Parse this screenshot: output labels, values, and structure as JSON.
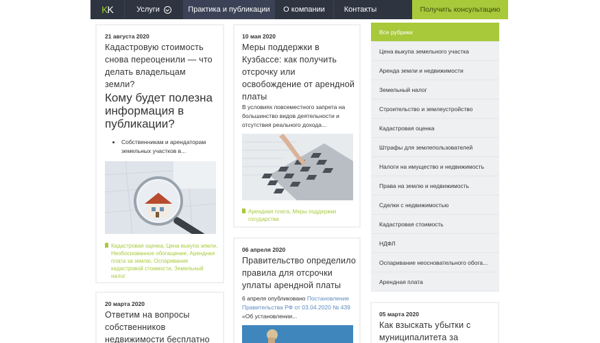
{
  "nav": {
    "logo_k1": "K",
    "logo_k2": "K",
    "services": "Услуги",
    "practice": "Практика и публикации",
    "company": "О компании",
    "contacts": "Контакты",
    "cta": "Получить консультацию"
  },
  "card1": {
    "date": "21 августа 2020",
    "title": "Кадастровую стоимость снова переоценили — что делать владельцам земли?",
    "subtitle": "Кому будет полезна информация в публикации?",
    "bullet": "Собственникам и арендаторам земельных участков в...",
    "tags": "Кадастровая оценка, Цена выкупа земли, Необоснованное обогащение, Арендная плата за землю, Оспаривание кадастровой стоимости, Земельный налог"
  },
  "card2": {
    "date": "10 мая 2020",
    "title": "Меры поддержки в Кузбассе: как получить отсрочку или освобождение от арендной платы",
    "text": "В условиях повсеместного запрета на большинство видов деятельности и отсутствия реального дохода...",
    "tags": "Арендная плата, Меры поддержки государства"
  },
  "card3": {
    "date": "06 апреля 2020",
    "title": "Правительство определило правила для отсрочки уплаты арендной платы",
    "text_prefix": "6 апреля опубликовано ",
    "text_link": "Постановление Правительства РФ от 03.04.2020 № 439",
    "text_suffix": " «Об установлении..."
  },
  "card4": {
    "date": "20 марта 2020",
    "title": "Ответим на вопросы собственников недвижимости бесплатно"
  },
  "card5": {
    "date": "05 марта 2020",
    "title": "Как взыскать убытки с муниципалитета за"
  },
  "sidebar": {
    "items": [
      "Все рубрики",
      "Цена выкупа земельного участка",
      "Аренда земли и недвижимости",
      "Земельный налог",
      "Строительство и землеустройство",
      "Кадастровая оценка",
      "Штрафы для землепользователей",
      "Налоги на имущество и недвижимость",
      "Права на землю и недвижимость",
      "Сделки с недвижимостью",
      "Кадастровая стоимость",
      "НДФЛ",
      "Оспаривание неосновательного обога...",
      "Арендная плата"
    ]
  },
  "colors": {
    "nav_bg": "#2e3440",
    "accent": "#a8c93a",
    "card_border": "#eef0f2",
    "link": "#5b8cbf"
  }
}
